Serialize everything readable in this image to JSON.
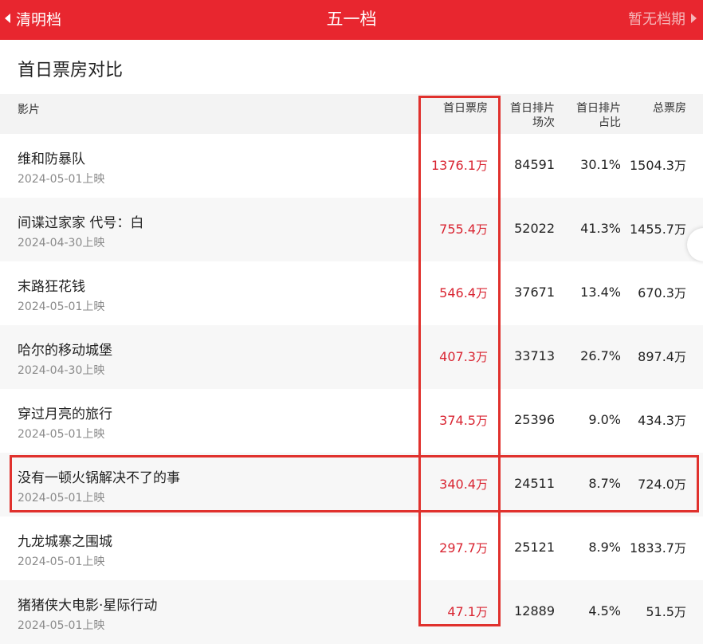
{
  "topbar": {
    "back_label": "清明档",
    "title": "五一档",
    "next_label": "暂无档期"
  },
  "section": {
    "title": "首日票房对比"
  },
  "columns": {
    "film": "影片",
    "first_day_box": "首日票房",
    "screenings_l1": "首日排片",
    "screenings_l2": "场次",
    "share_l1": "首日排片",
    "share_l2": "占比",
    "total_box": "总票房"
  },
  "unit": "万",
  "rows": [
    {
      "name": "维和防暴队",
      "date": "2024-05-01上映",
      "first_day": "1376.1",
      "screenings": "84591",
      "share": "30.1%",
      "total": "1504.3"
    },
    {
      "name": "间谍过家家 代号：白",
      "date": "2024-04-30上映",
      "first_day": "755.4",
      "screenings": "52022",
      "share": "41.3%",
      "total": "1455.7"
    },
    {
      "name": "末路狂花钱",
      "date": "2024-05-01上映",
      "first_day": "546.4",
      "screenings": "37671",
      "share": "13.4%",
      "total": "670.3"
    },
    {
      "name": "哈尔的移动城堡",
      "date": "2024-04-30上映",
      "first_day": "407.3",
      "screenings": "33713",
      "share": "26.7%",
      "total": "897.4"
    },
    {
      "name": "穿过月亮的旅行",
      "date": "2024-05-01上映",
      "first_day": "374.5",
      "screenings": "25396",
      "share": "9.0%",
      "total": "434.3"
    },
    {
      "name": "没有一顿火锅解决不了的事",
      "date": "2024-05-01上映",
      "first_day": "340.4",
      "screenings": "24511",
      "share": "8.7%",
      "total": "724.0"
    },
    {
      "name": "九龙城寨之围城",
      "date": "2024-05-01上映",
      "first_day": "297.7",
      "screenings": "25121",
      "share": "8.9%",
      "total": "1833.7"
    },
    {
      "name": "猪猪侠大电影·星际行动",
      "date": "2024-05-01上映",
      "first_day": "47.1",
      "screenings": "12889",
      "share": "4.5%",
      "total": "51.5"
    }
  ],
  "colors": {
    "brand": "#e8262f",
    "highlight": "#d92532"
  }
}
